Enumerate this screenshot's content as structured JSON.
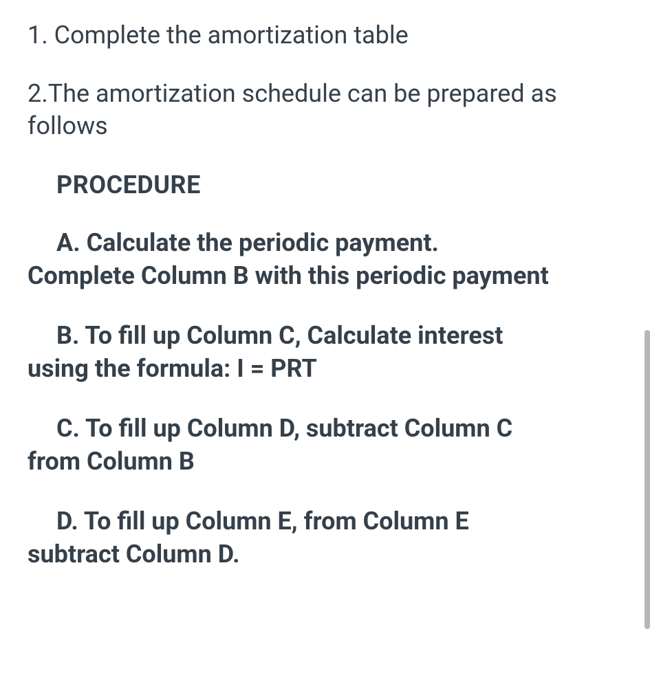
{
  "item1": "1. Complete the amortization table",
  "item2": "2.The amortization schedule can be prepared as follows",
  "procedureHeading": "PROCEDURE",
  "steps": {
    "a": {
      "line1": "A.  Calculate the periodic payment.",
      "line2": "Complete Column B with this periodic payment"
    },
    "b": {
      "line1": "B.  To fill up Column C, Calculate interest",
      "line2": "using the formula:   I = PRT"
    },
    "c": {
      "line1": "C.  To fill up Column D, subtract Column C",
      "line2": "from Column B"
    },
    "d": {
      "line1": "D. To fill up Column E,  from Column E",
      "line2": "subtract Column D."
    }
  }
}
